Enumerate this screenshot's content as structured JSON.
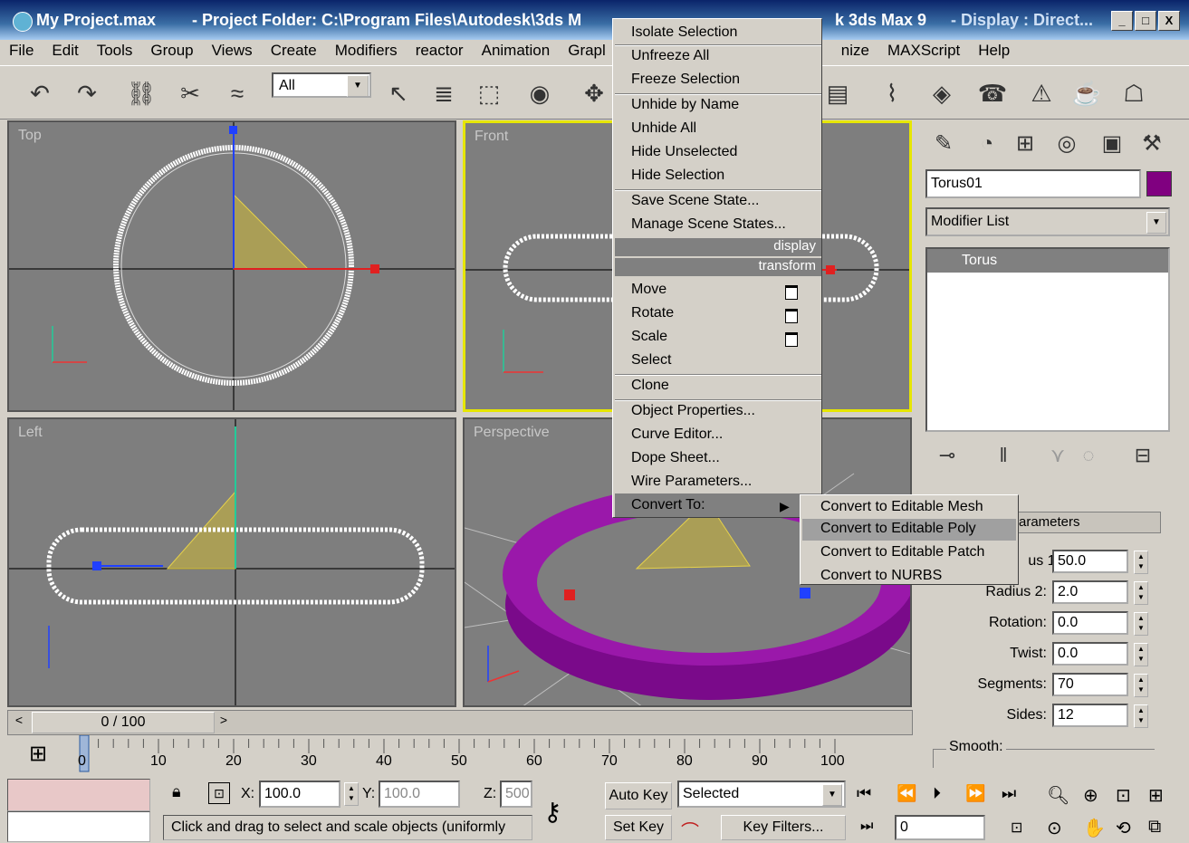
{
  "window": {
    "title_file": "My Project.max",
    "title_folder": "- Project Folder: C:\\Program Files\\Autodesk\\3ds M",
    "title_app": "k 3ds Max 9",
    "title_display": "- Display : Direct...",
    "buttons": [
      "_",
      "□",
      "X"
    ]
  },
  "menubar": [
    "File",
    "Edit",
    "Tools",
    "Group",
    "Views",
    "Create",
    "Modifiers",
    "reactor",
    "Animation",
    "Grapl",
    "nize",
    "MAXScript",
    "Help"
  ],
  "toolbar": {
    "selection_filter": "All"
  },
  "viewports": {
    "top": "Top",
    "front": "Front",
    "left": "Left",
    "perspective": "Perspective"
  },
  "context_menu": {
    "display_header": "display",
    "transform_header": "transform",
    "group1": [
      "Isolate Selection",
      "Unfreeze All",
      "Freeze Selection"
    ],
    "group2": [
      "Unhide by Name",
      "Unhide All",
      "Hide Unselected",
      "Hide Selection"
    ],
    "group3": [
      "Save Scene State...",
      "Manage Scene States..."
    ],
    "transform_items": [
      "Move",
      "Rotate",
      "Scale",
      "Select"
    ],
    "clone": "Clone",
    "group4": [
      "Object Properties...",
      "Curve Editor...",
      "Dope Sheet...",
      "Wire Parameters..."
    ],
    "convert_to": "Convert To:",
    "submenu": [
      "Convert to Editable Mesh",
      "Convert to Editable Poly",
      "Convert to Editable Patch",
      "Convert to NURBS"
    ],
    "submenu_highlight": "Convert to Editable Poly"
  },
  "command_panel": {
    "object_name": "Torus01",
    "object_color": "#800080",
    "modifier_list": "Modifier List",
    "stack_item": "Torus",
    "rollout_title": "arameters",
    "params": [
      {
        "label": "us 1:",
        "value": "50.0"
      },
      {
        "label": "Radius 2:",
        "value": "2.0"
      },
      {
        "label": "Rotation:",
        "value": "0.0"
      },
      {
        "label": "Twist:",
        "value": "0.0"
      },
      {
        "label": "Segments:",
        "value": "70"
      },
      {
        "label": "Sides:",
        "value": "12"
      }
    ],
    "smooth_label": "Smooth:"
  },
  "timeline": {
    "frame": "0 / 100",
    "ticks": [
      "0",
      "10",
      "20",
      "30",
      "40",
      "50",
      "60",
      "70",
      "80",
      "90",
      "100"
    ]
  },
  "status": {
    "x_label": "X:",
    "x_value": "100.0",
    "y_label": "Y:",
    "y_value": "100.0",
    "z_label": "Z:",
    "z_value": "500",
    "prompt": "Click and drag to select and scale objects (uniformly",
    "auto_key": "Auto Key",
    "set_key": "Set Key",
    "key_mode": "Selected",
    "key_filters": "Key Filters...",
    "current_frame": "0"
  },
  "colors": {
    "torus": "#800080",
    "viewport_bg": "#7e7e7e",
    "active_border": "#e6e600"
  }
}
